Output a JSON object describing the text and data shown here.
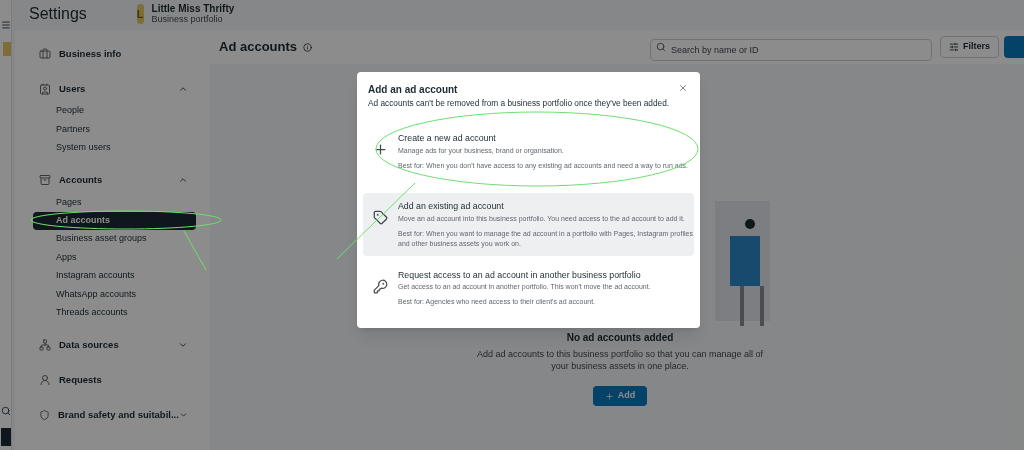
{
  "header": {
    "title": "Settings",
    "avatar_letter": "L",
    "portfolio_name": "Little Miss Thrifty",
    "portfolio_type": "Business portfolio"
  },
  "sidebar": {
    "sections": [
      {
        "label": "Business info"
      },
      {
        "label": "Users",
        "expanded": true,
        "children": [
          {
            "label": "People",
            "selected": false
          },
          {
            "label": "Partners",
            "selected": false
          },
          {
            "label": "System users",
            "selected": false
          }
        ]
      },
      {
        "label": "Accounts",
        "expanded": true,
        "children": [
          {
            "label": "Pages",
            "selected": false
          },
          {
            "label": "Ad accounts",
            "selected": true
          },
          {
            "label": "Business asset groups",
            "selected": false
          },
          {
            "label": "Apps",
            "selected": false
          },
          {
            "label": "Instagram accounts",
            "selected": false
          },
          {
            "label": "WhatsApp accounts",
            "selected": false
          },
          {
            "label": "Threads accounts",
            "selected": false
          }
        ]
      },
      {
        "label": "Data sources",
        "expanded": false
      },
      {
        "label": "Requests"
      },
      {
        "label": "Brand safety and suitabil...",
        "expanded": false
      }
    ]
  },
  "main": {
    "title": "Ad accounts",
    "search": {
      "placeholder": "Search by name or ID"
    },
    "filters_button": "Filters",
    "empty_title": "No ad accounts added",
    "empty_text": "Add ad accounts to this business portfolio so that you can manage all of your business assets in one place.",
    "add_button": "Add"
  },
  "modal": {
    "title": "Add an ad account",
    "subtitle": "Ad accounts can't be removed from a business portfolio once they've been added.",
    "options": [
      {
        "title": "Create a new ad account",
        "description": "Manage ads for your business, brand or organisation.",
        "best_for": "Best for: When you don't have access to any existing ad accounts and need a way to run ads.",
        "highlighted": false
      },
      {
        "title": "Add an existing ad account",
        "description": "Move an ad account into this business portfolio. You need access to the ad account to add it.",
        "best_for": "Best for: When you want to manage the ad account in a portfolio with Pages, Instagram profiles and other business assets you work on.",
        "highlighted": true
      },
      {
        "title": "Request access to an ad account in another business portfolio",
        "description": "Get access to an ad account in another portfolio. This won't move the ad account.",
        "best_for": "Best for: Agencies who need access to their client's ad account.",
        "highlighted": false
      }
    ]
  }
}
